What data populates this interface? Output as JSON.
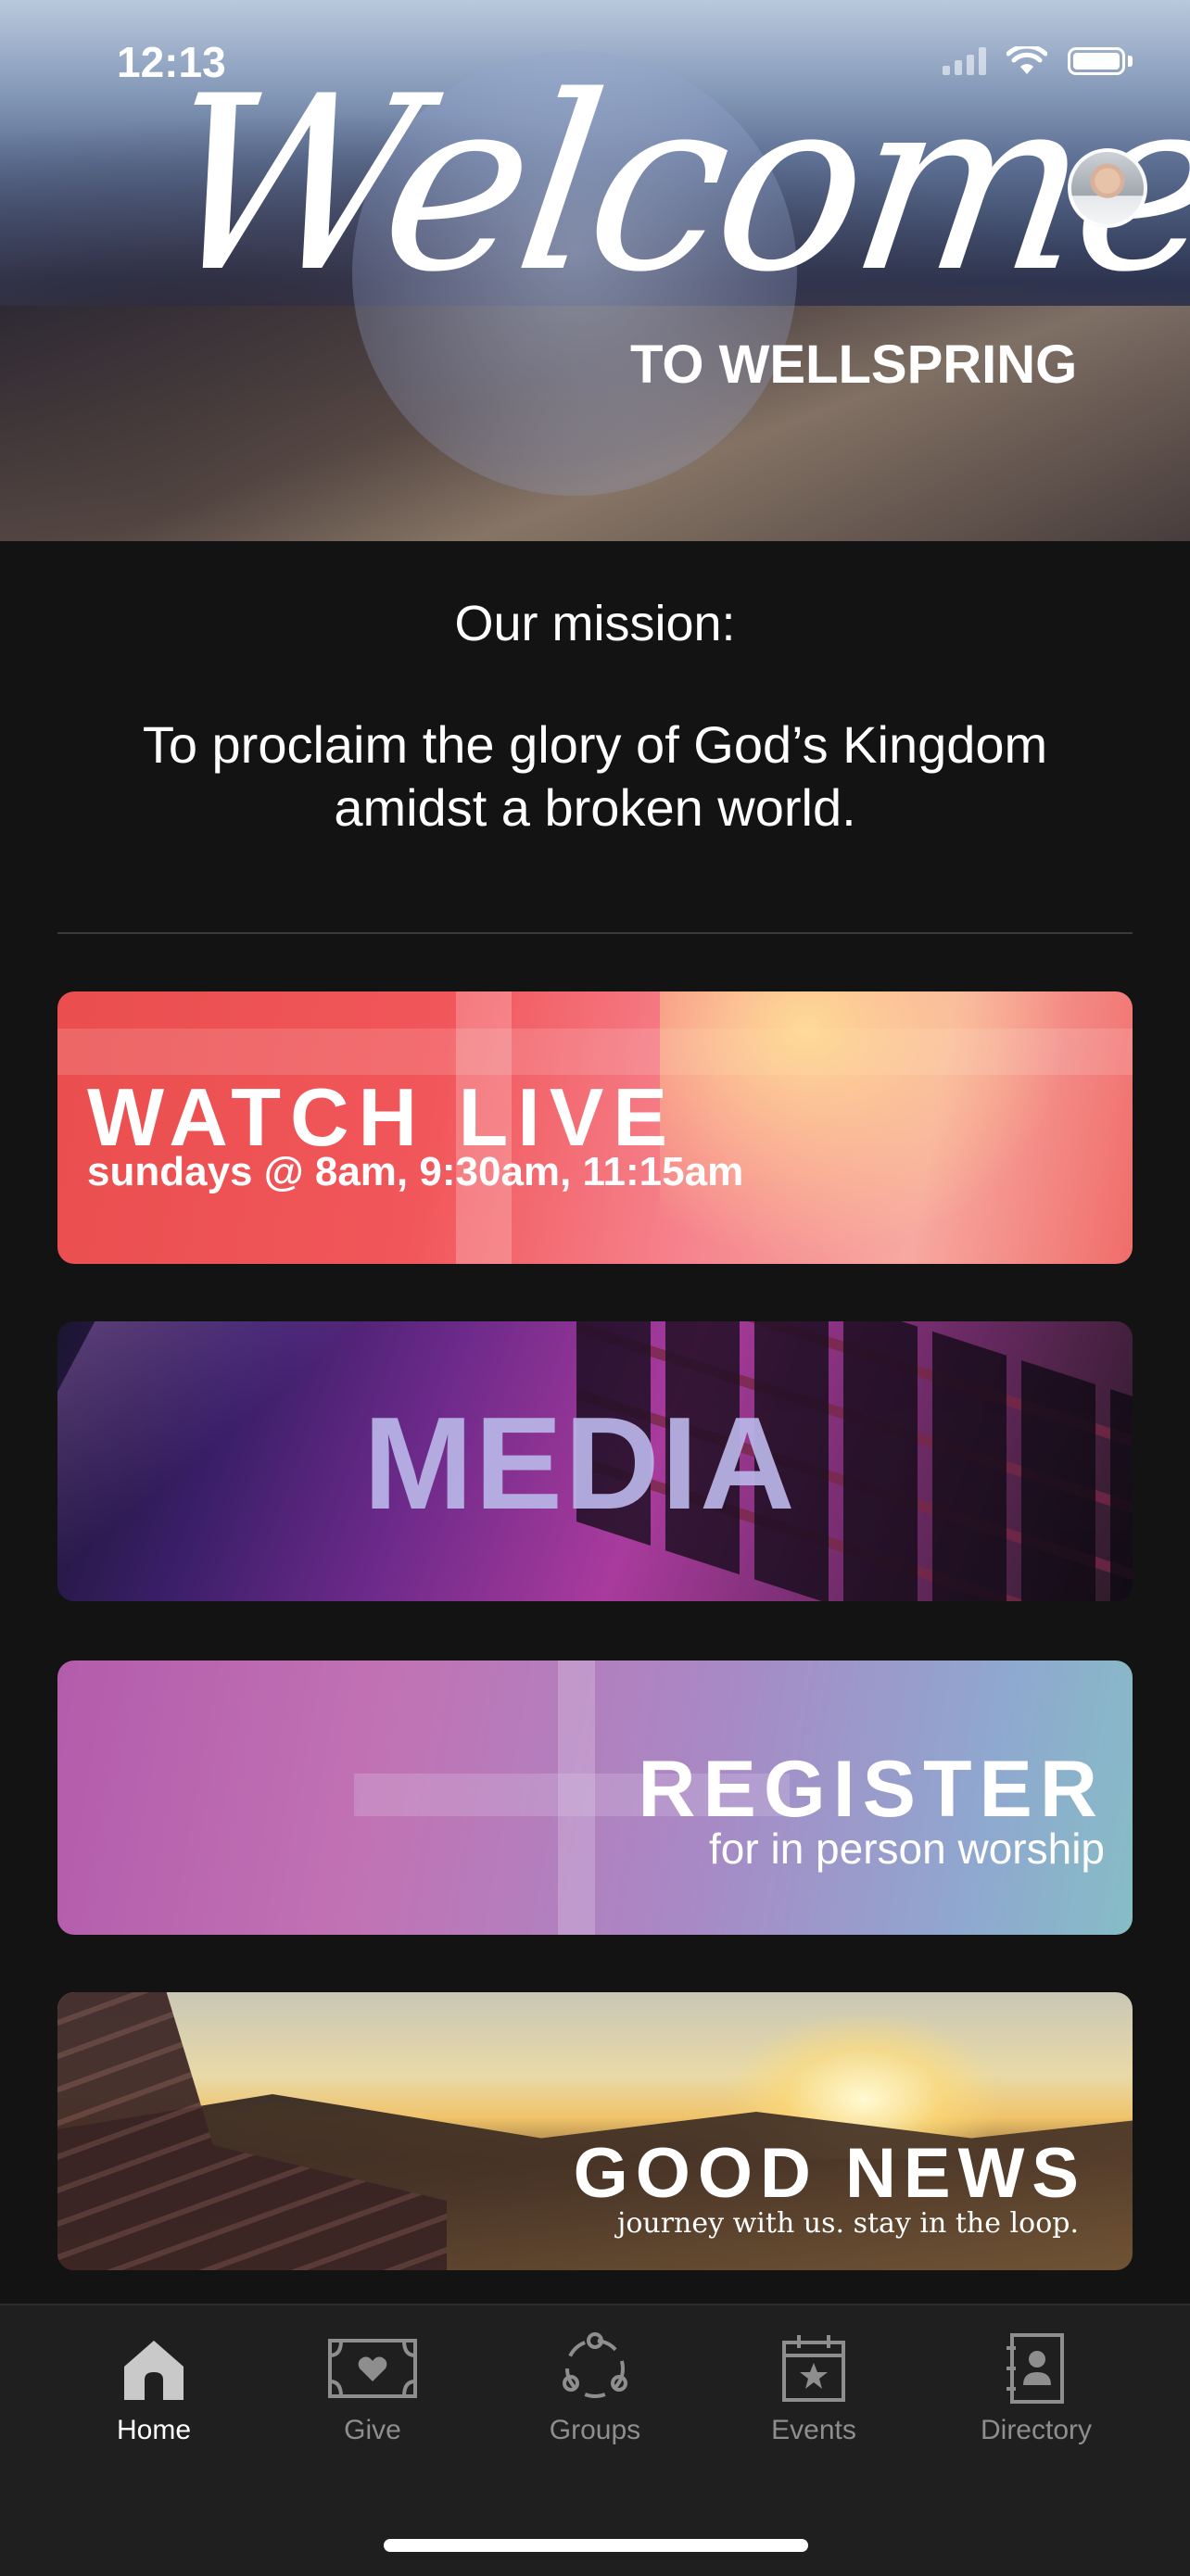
{
  "status_bar": {
    "time": "12:13"
  },
  "hero": {
    "welcome_script": "Welcome",
    "welcome_subtitle": "TO WELLSPRING"
  },
  "mission": {
    "label": "Our mission:",
    "text": "To proclaim the glory of God’s Kingdom amidst a broken world."
  },
  "banners": [
    {
      "title": "WATCH LIVE",
      "subtitle": "sundays @ 8am, 9:30am, 11:15am"
    },
    {
      "title": "MEDIA"
    },
    {
      "title": "REGISTER",
      "subtitle": "for in person worship"
    },
    {
      "title": "GOOD NEWS",
      "subtitle": "journey with us. stay in the loop."
    }
  ],
  "tabbar": {
    "items": [
      {
        "label": "Home",
        "icon": "home-icon",
        "active": true
      },
      {
        "label": "Give",
        "icon": "give-icon",
        "active": false
      },
      {
        "label": "Groups",
        "icon": "groups-icon",
        "active": false
      },
      {
        "label": "Events",
        "icon": "events-icon",
        "active": false
      },
      {
        "label": "Directory",
        "icon": "directory-icon",
        "active": false
      }
    ]
  },
  "colors": {
    "background": "#131313",
    "tabbar": "#1f1f1f",
    "active_tab": "#ffffff",
    "inactive_tab": "#8e8e8e"
  }
}
